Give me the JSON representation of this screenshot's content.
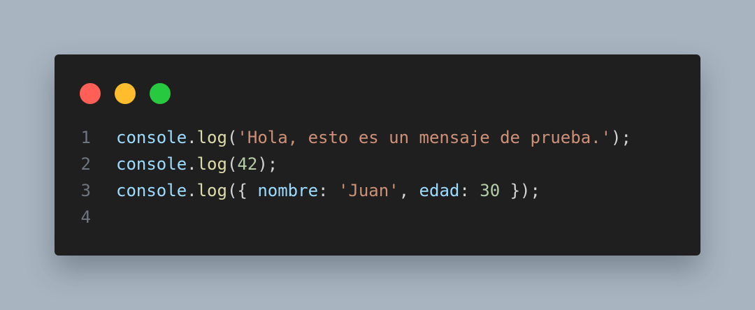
{
  "window_controls": {
    "close": {
      "icon": "close-dot-icon",
      "color": "#ff5f56"
    },
    "minimize": {
      "icon": "minimize-dot-icon",
      "color": "#ffbd2e"
    },
    "maximize": {
      "icon": "maximize-dot-icon",
      "color": "#27c93f"
    }
  },
  "code": {
    "lines": [
      {
        "number": "1",
        "tokens": [
          {
            "type": "obj",
            "text": "console"
          },
          {
            "type": "punc",
            "text": "."
          },
          {
            "type": "fn",
            "text": "log"
          },
          {
            "type": "punc",
            "text": "("
          },
          {
            "type": "str",
            "text": "'Hola, esto es un mensaje de prueba.'"
          },
          {
            "type": "punc",
            "text": ");"
          }
        ]
      },
      {
        "number": "2",
        "tokens": [
          {
            "type": "obj",
            "text": "console"
          },
          {
            "type": "punc",
            "text": "."
          },
          {
            "type": "fn",
            "text": "log"
          },
          {
            "type": "punc",
            "text": "("
          },
          {
            "type": "num",
            "text": "42"
          },
          {
            "type": "punc",
            "text": ");"
          }
        ]
      },
      {
        "number": "3",
        "tokens": [
          {
            "type": "obj",
            "text": "console"
          },
          {
            "type": "punc",
            "text": "."
          },
          {
            "type": "fn",
            "text": "log"
          },
          {
            "type": "punc",
            "text": "({ "
          },
          {
            "type": "prop",
            "text": "nombre"
          },
          {
            "type": "punc",
            "text": ": "
          },
          {
            "type": "str",
            "text": "'Juan'"
          },
          {
            "type": "punc",
            "text": ", "
          },
          {
            "type": "prop",
            "text": "edad"
          },
          {
            "type": "punc",
            "text": ": "
          },
          {
            "type": "num",
            "text": "30"
          },
          {
            "type": "punc",
            "text": " });"
          }
        ]
      },
      {
        "number": "4",
        "tokens": []
      }
    ]
  }
}
